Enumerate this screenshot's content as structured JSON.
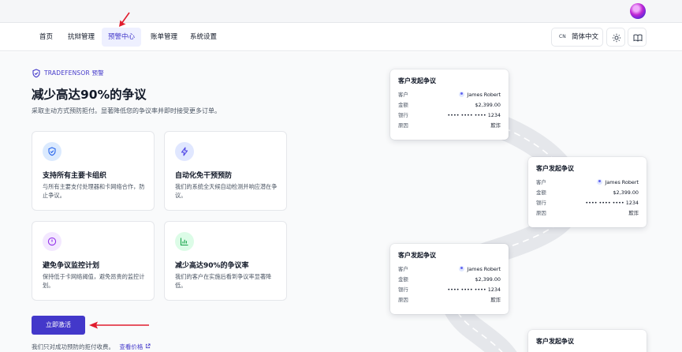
{
  "nav": {
    "items": [
      {
        "label": "首页",
        "active": false
      },
      {
        "label": "抗辩管理",
        "active": false
      },
      {
        "label": "预警中心",
        "active": true
      },
      {
        "label": "账单管理",
        "active": false
      },
      {
        "label": "系统设置",
        "active": false
      }
    ],
    "language": {
      "code": "CN",
      "label": "简体中文"
    }
  },
  "hero": {
    "brand": "TRADEFENSOR 预警",
    "headline": "减少高达90%的争议",
    "subhead": "采取主动方式预防拒付。显著降低您的争议率并即时接受更多订单。"
  },
  "features": [
    {
      "title": "支持所有主要卡组织",
      "desc": "与所有主要支付处理器和卡网络合作，防止争议。",
      "icon": "shield-check-icon",
      "color": "#2563eb"
    },
    {
      "title": "自动化免干预预防",
      "desc": "我们的系统全天候自动检测并响应潜在争议。",
      "icon": "lightning-icon",
      "color": "#4f46e5"
    },
    {
      "title": "避免争议监控计划",
      "desc": "保持低于卡网络阈值，避免昂贵的监控计划。",
      "icon": "alert-circle-icon",
      "color": "#9333ea"
    },
    {
      "title": "减少高达90%的争议率",
      "desc": "我们的客户在实施后看到争议率显著降低。",
      "icon": "bar-chart-icon",
      "color": "#16a34a"
    }
  ],
  "cta": {
    "button": "立即激活",
    "footnote": "我们只对成功预防的拒付收费。",
    "link": "查看价格"
  },
  "dispute_card": {
    "title": "客户发起争议",
    "rows": [
      {
        "key": "客户",
        "value": "James Robert"
      },
      {
        "key": "金额",
        "value": "$2,399.00"
      },
      {
        "key": "银行",
        "value": "•••• •••• •••• 1234"
      },
      {
        "key": "原因",
        "value": "欺诈"
      }
    ]
  },
  "colors": {
    "accent": "#4338ca",
    "annotation": "#e11d2e"
  }
}
